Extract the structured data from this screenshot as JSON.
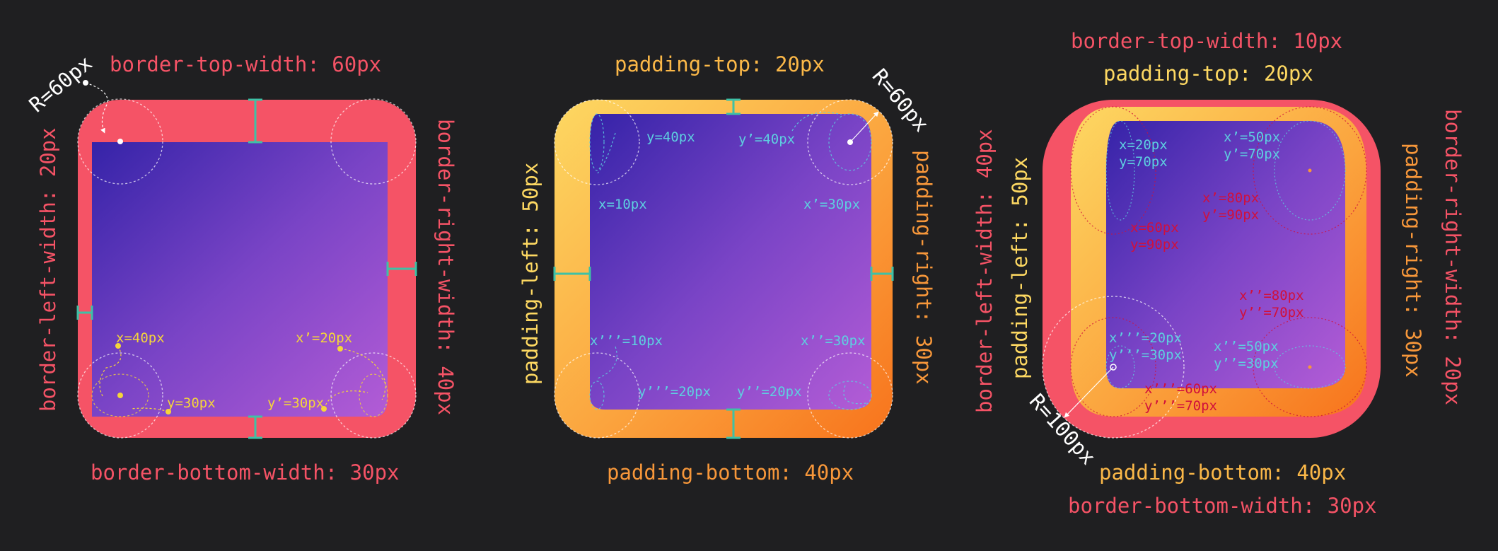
{
  "colors": {
    "background": "#1f1f21",
    "border": "#f55366",
    "padding_light": "#fdd862",
    "padding_dark": "#f77b1e",
    "content_start": "#3523a8",
    "content_end": "#b35cd6",
    "teal": "#3ec1a6",
    "cyan_text": "#5ecfe0",
    "yellow_text": "#f5d53a",
    "crimson_text": "#d0103c",
    "white": "#ffffff"
  },
  "diagram1": {
    "border_top": "border-top-width: 60px",
    "border_left": "border-left-width: 20px",
    "border_right": "border-right-width: 40px",
    "border_bottom": "border-bottom-width: 30px",
    "radius": "R=60px",
    "x_tl": "x=40px",
    "y_tl": "y=30px",
    "x_tr": "x’=20px",
    "y_tr": "y’=30px"
  },
  "diagram2": {
    "padding_top": "padding-top: 20px",
    "padding_left": "padding-left: 50px",
    "padding_right": "padding-right: 30px",
    "padding_bottom": "padding-bottom: 40px",
    "radius": "R=60px",
    "x_tl": "x=10px",
    "y_tl": "y=40px",
    "x_tr": "x’=30px",
    "y_tr": "y’=40px",
    "x_br": "x’’=30px",
    "y_br": "y’’=20px",
    "x_bl": "x’’’=10px",
    "y_bl": "y’’’=20px"
  },
  "diagram3": {
    "border_top": "border-top-width: 10px",
    "padding_top": "padding-top: 20px",
    "border_left": "border-left-width: 40px",
    "padding_left": "padding-left: 50px",
    "padding_right": "padding-right: 30px",
    "border_right": "border-right-width: 20px",
    "padding_bottom": "padding-bottom: 40px",
    "border_bottom": "border-bottom-width: 30px",
    "radius": "R=100px",
    "cyan_tl": [
      "x=20px",
      "y=70px"
    ],
    "cyan_tr": [
      "x’=50px",
      "y’=70px"
    ],
    "red_tr": [
      "x’=80px",
      "y’=90px"
    ],
    "red_tl": [
      "x=60px",
      "y=90px"
    ],
    "red_br": [
      "x’’=80px",
      "y’’=70px"
    ],
    "cyan_bl": [
      "x’’’=20px",
      "y’’’=30px"
    ],
    "cyan_br": [
      "x’’=50px",
      "y’’=30px"
    ],
    "red_bl": [
      "x’’’=60px",
      "y’’’=70px"
    ]
  }
}
